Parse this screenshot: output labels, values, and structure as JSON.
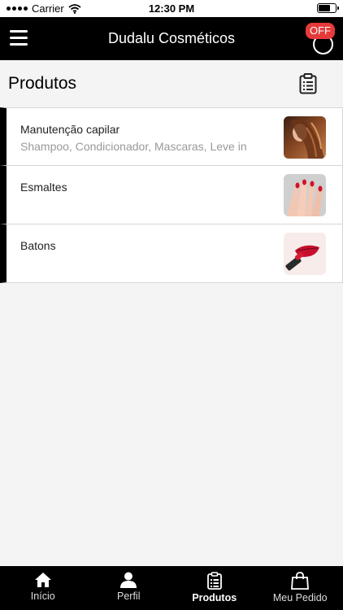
{
  "status_bar": {
    "carrier": "Carrier",
    "time": "12:30 PM"
  },
  "nav": {
    "title": "Dudalu Cosméticos",
    "off_badge": "OFF"
  },
  "section": {
    "title": "Produtos"
  },
  "products": [
    {
      "title": "Manutenção capilar",
      "subtitle": "Shampoo, Condicionador, Mascaras, Leve in",
      "image": "hair-photo"
    },
    {
      "title": "Esmaltes",
      "subtitle": "",
      "image": "nails-photo"
    },
    {
      "title": "Batons",
      "subtitle": "",
      "image": "lipstick-photo"
    }
  ],
  "tabs": [
    {
      "label": "Início",
      "icon": "home-icon",
      "active": false
    },
    {
      "label": "Perfil",
      "icon": "user-icon",
      "active": false
    },
    {
      "label": "Produtos",
      "icon": "clipboard-icon",
      "active": true
    },
    {
      "label": "Meu Pedido",
      "icon": "shopping-bag-icon",
      "active": false
    }
  ]
}
